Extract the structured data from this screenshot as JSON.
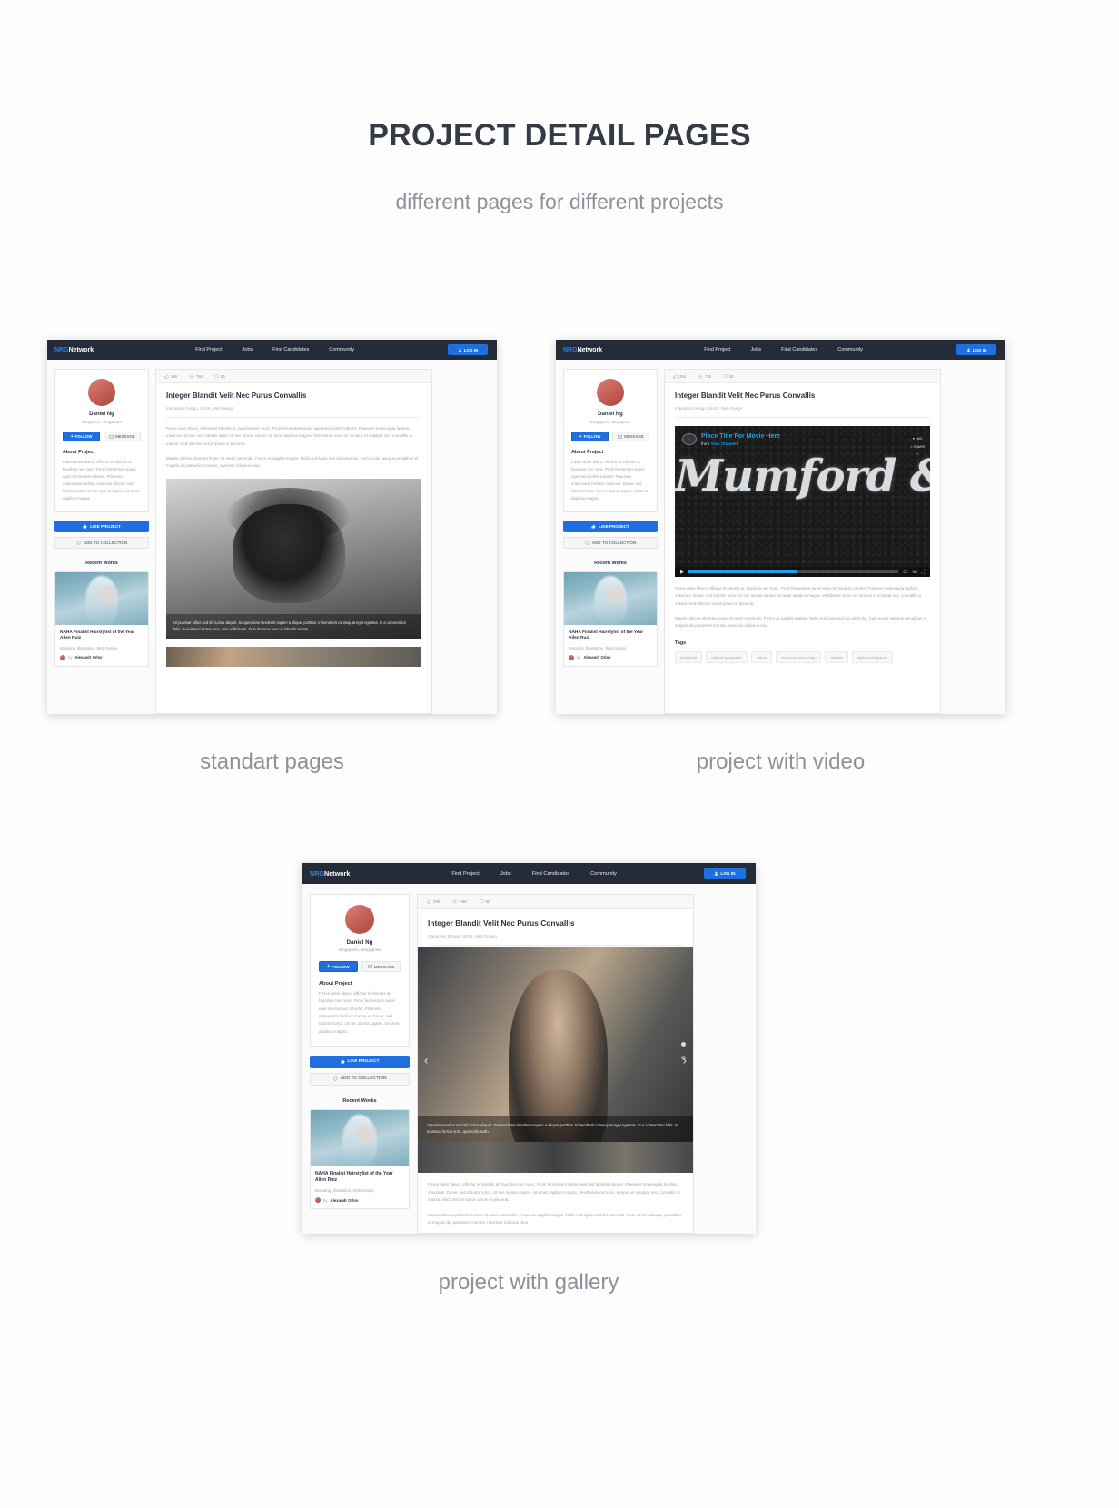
{
  "hero": {
    "title": "PROJECT DETAIL PAGES",
    "subtitle": "different pages for different projects"
  },
  "captions": {
    "standart": "standart pages",
    "video": "project with video",
    "gallery": "project with gallery"
  },
  "nav": {
    "logo_accent": "NRG",
    "logo_rest": "Network",
    "links": [
      "Find Project",
      "Jobs",
      "Find Candidates",
      "Community"
    ],
    "login": "LOG IN",
    "login_icon": "user-icon",
    "bg": "#242b39",
    "accent": "#2f7ced"
  },
  "profile": {
    "avatar_icon": "avatar",
    "name": "Daniel Ng",
    "location": "Singapore, Singapore",
    "follow_label": "FOLLOW",
    "follow_icon": "plus-icon",
    "message_label": "MESSAGE",
    "message_icon": "envelope-icon",
    "about_heading": "About Project",
    "about_text": "Fusce dolor libero, efficitur et lobortis at, faucibus nec nunc. Proin fermentum turpis eget nisi facilisis lobortis. Praesent malesuada facilisis maximus. Donec sed lobortis tortor. Ut nec lacinia sapien, sit amet dapibus magna.",
    "like_label": "LIKE PROJECT",
    "like_icon": "thumbs-up-icon",
    "collect_label": "ADD TO COLLECTION",
    "collect_icon": "collection-icon"
  },
  "recent": {
    "heading": "Recent Works",
    "work_title": "NAHA Finalist Hairstylist of the Year",
    "work_author": "Allen Ruiz",
    "work_tags": "Branding, Illustration, Web Design",
    "by_prefix": "by",
    "by_name": "Alexandr Orlov"
  },
  "stats": {
    "likes": "250",
    "views": "750",
    "comments": "50",
    "like_icon": "thumbs-up-icon",
    "view_icon": "eye-icon",
    "comment_icon": "comment-icon"
  },
  "project": {
    "title": "Integer Blandit Velit Nec Purus Convallis",
    "tags_line": "Interaction Design, UI/UX, Web Design",
    "para1": "Fusce dolor libero, efficitur et lobortis at, faucibus nec nunc. Proin fermentum turpis eget nisi facilisis lobortis. Praesent malesuada facilisis maximus. Donec sed lobortis tortor. Ut nec lacinia sapien, sit amet dapibus magna. Vestibulum nunc ex, tempus et volutpat nec, convallis ut massa. Sed ultricies luctus ipsum in placerat.",
    "para2": "Mauris ultrices pharetra lectus sit amet commodo. Fusce ac sagittis magna. Nulla sed ligula sed dui amet dui. Cum sociis natoque penatibus et magnis dis parturient montes, nascetur ridiculus mus.",
    "photo_overlay": "Ut pulvinar tellus sed elit luctus aliquet. Suspendisse hendrerit sapien a aliquet porttitor. In hendrerit consequat eget egestas. In a consectetur felis. In euismod lectus eros, quis sollicitudin. Duis rhoncus nunc in lobortis lacinia."
  },
  "video": {
    "title": "Place Title For Movie Here",
    "from_prefix": "from",
    "channel": "Your Channel",
    "wordmark": "Mumford & Sons",
    "side_actions": [
      "LIKE",
      "SHARE",
      "+"
    ],
    "play_icon": "play-icon",
    "hd_label": "HD",
    "fullscreen_icon": "fullscreen-icon",
    "cc_label": "CC"
  },
  "tags_section": {
    "heading": "Tags",
    "items": [
      "photoshop",
      "national geographic",
      "nature",
      "respinsive web design",
      "animals",
      "digital photography"
    ]
  },
  "gallery": {
    "prev_icon": "chevron-left-icon",
    "next_icon": "chevron-right-icon",
    "caption": "Ut pulvinar tellus sed elit luctus aliquet. Suspendisse hendrerit sapien a aliquet porttitor. In hendrerit consequat eget egestas. In a consectetur felis. In euismod lectus eros, quis sollicitudin."
  }
}
